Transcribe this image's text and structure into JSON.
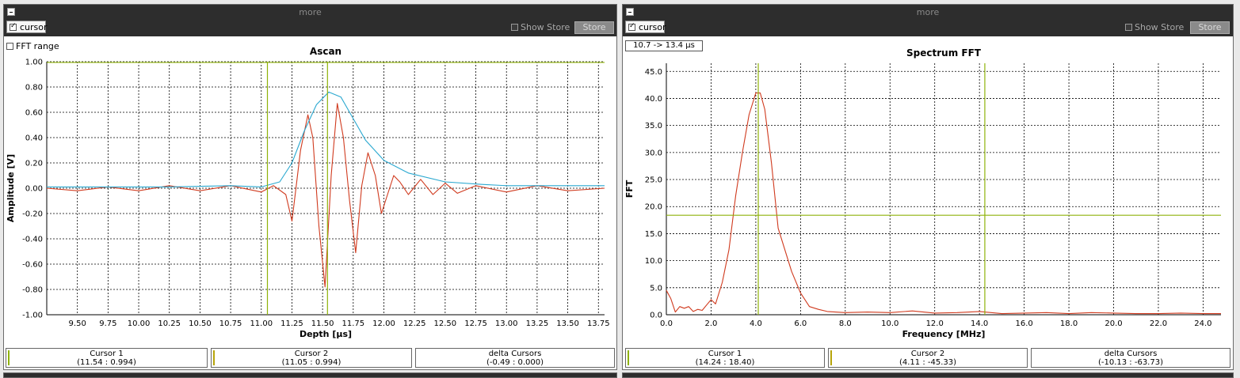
{
  "colors": {
    "wave": "#d03a1e",
    "envelope": "#2aa8d0",
    "cursor": "#8fb20a",
    "grid": "#000000",
    "titlebar": "#2d2d2d"
  },
  "panels": [
    {
      "header": {
        "title": "more"
      },
      "toolbar": {
        "cursor_label": "cursor",
        "cursor_checked": true,
        "show_store_label": "Show Store",
        "store_label": "Store"
      },
      "fft_range_label": "FFT range",
      "readouts": [
        {
          "label": "Cursor 1",
          "value": "(11.54 : 0.994)"
        },
        {
          "label": "Cursor 2",
          "value": "(11.05 : 0.994)"
        },
        {
          "label": "delta Cursors",
          "value": "(-0.49 : 0.000)"
        }
      ]
    },
    {
      "header": {
        "title": "more"
      },
      "toolbar": {
        "cursor_label": "cursor",
        "cursor_checked": true,
        "show_store_label": "Show Store",
        "store_label": "Store"
      },
      "range_label": "10.7 -> 13.4 µs",
      "readouts": [
        {
          "label": "Cursor 1",
          "value": "(14.24 : 18.40)"
        },
        {
          "label": "Cursor 2",
          "value": "(4.11 : -45.33)"
        },
        {
          "label": "delta Cursors",
          "value": "(-10.13 : -63.73)"
        }
      ]
    }
  ],
  "chart_data": [
    {
      "type": "line",
      "title": "Ascan",
      "xlabel": "Depth [µs]",
      "ylabel": "Amplitude [V]",
      "xlim": [
        9.25,
        13.8
      ],
      "ylim": [
        -1.0,
        1.0
      ],
      "grid": true,
      "xticks": [
        9.5,
        9.75,
        10.0,
        10.25,
        10.5,
        10.75,
        11.0,
        11.25,
        11.5,
        11.75,
        12.0,
        12.25,
        12.5,
        12.75,
        13.0,
        13.25,
        13.5,
        13.75
      ],
      "xtick_labels": [
        "9.50",
        "9.75",
        "10.00",
        "10.25",
        "10.50",
        "10.75",
        "11.00",
        "11.25",
        "11.50",
        "11.75",
        "12.00",
        "12.25",
        "12.50",
        "12.75",
        "13.00",
        "13.25",
        "13.50",
        "13.75"
      ],
      "yticks": [
        1.0,
        0.8,
        0.6,
        0.4,
        0.2,
        0.0,
        -0.2,
        -0.4,
        -0.6,
        -0.8,
        -1.0
      ],
      "ytick_labels": [
        "1.00",
        "0.80",
        "0.60",
        "0.40",
        "0.20",
        "0.00",
        "-0.20",
        "-0.40",
        "-0.60",
        "-0.80",
        "-1.00"
      ],
      "cursors": {
        "x": [
          11.05,
          11.54
        ],
        "y": [
          0.994
        ]
      },
      "series": [
        {
          "color": "#d03a1e",
          "x": [
            9.25,
            9.5,
            9.75,
            10.0,
            10.25,
            10.5,
            10.75,
            11.0,
            11.1,
            11.2,
            11.25,
            11.32,
            11.38,
            11.42,
            11.47,
            11.52,
            11.57,
            11.62,
            11.67,
            11.72,
            11.77,
            11.82,
            11.87,
            11.93,
            11.98,
            12.03,
            12.08,
            12.13,
            12.2,
            12.3,
            12.4,
            12.5,
            12.6,
            12.75,
            13.0,
            13.25,
            13.5,
            13.8
          ],
          "y": [
            0.0,
            -0.02,
            0.01,
            -0.02,
            0.02,
            -0.02,
            0.02,
            -0.03,
            0.02,
            -0.05,
            -0.26,
            0.3,
            0.58,
            0.4,
            -0.3,
            -0.78,
            0.1,
            0.67,
            0.4,
            -0.1,
            -0.51,
            0.02,
            0.28,
            0.1,
            -0.2,
            -0.05,
            0.1,
            0.05,
            -0.05,
            0.07,
            -0.05,
            0.04,
            -0.04,
            0.02,
            -0.03,
            0.02,
            -0.02,
            0.0
          ]
        },
        {
          "color": "#2aa8d0",
          "x": [
            9.25,
            9.75,
            10.25,
            10.75,
            11.0,
            11.15,
            11.25,
            11.35,
            11.45,
            11.55,
            11.65,
            11.75,
            11.85,
            12.0,
            12.2,
            12.5,
            12.8,
            13.0,
            13.5,
            13.8
          ],
          "y": [
            0.01,
            0.01,
            0.01,
            0.02,
            0.01,
            0.05,
            0.2,
            0.45,
            0.66,
            0.76,
            0.72,
            0.55,
            0.38,
            0.22,
            0.12,
            0.05,
            0.03,
            0.02,
            0.02,
            0.02
          ]
        }
      ]
    },
    {
      "type": "line",
      "title": "Spectrum FFT",
      "xlabel": "Frequency [MHz]",
      "ylabel": "FFT",
      "xlim": [
        0,
        24.8
      ],
      "ylim": [
        0,
        46.5
      ],
      "grid": true,
      "xticks": [
        0,
        2,
        4,
        6,
        8,
        10,
        12,
        14,
        16,
        18,
        20,
        22,
        24
      ],
      "xtick_labels": [
        "0.0",
        "2.0",
        "4.0",
        "6.0",
        "8.0",
        "10.0",
        "12.0",
        "14.0",
        "16.0",
        "18.0",
        "20.0",
        "22.0",
        "24.0"
      ],
      "yticks": [
        0,
        5,
        10,
        15,
        20,
        25,
        30,
        35,
        40,
        45
      ],
      "ytick_labels": [
        "0.0",
        "5.0",
        "10.0",
        "15.0",
        "20.0",
        "25.0",
        "30.0",
        "35.0",
        "40.0",
        "45.0"
      ],
      "cursors": {
        "x": [
          4.11,
          14.24
        ],
        "y": [
          18.4
        ]
      },
      "series": [
        {
          "color": "#d03a1e",
          "x": [
            0,
            0.2,
            0.4,
            0.6,
            0.8,
            1.0,
            1.2,
            1.4,
            1.6,
            1.8,
            2.0,
            2.2,
            2.5,
            2.8,
            3.1,
            3.4,
            3.7,
            4.0,
            4.2,
            4.4,
            4.7,
            5.0,
            5.3,
            5.6,
            6.0,
            6.4,
            6.8,
            7.2,
            8.0,
            9.0,
            10.0,
            11.0,
            12.0,
            13.0,
            14.0,
            15.0,
            16.0,
            17.0,
            18.0,
            19.0,
            20.0,
            21.0,
            22.0,
            23.0,
            24.0,
            24.8
          ],
          "y": [
            4.5,
            3.0,
            0.5,
            1.5,
            1.2,
            1.5,
            0.6,
            1.0,
            0.8,
            1.8,
            2.8,
            2.0,
            6.0,
            12.0,
            22.0,
            30.0,
            37.0,
            41.0,
            41.0,
            38.0,
            28.0,
            16.0,
            12.0,
            8.0,
            4.0,
            1.5,
            1.0,
            0.6,
            0.4,
            0.5,
            0.4,
            0.7,
            0.3,
            0.4,
            0.6,
            0.2,
            0.3,
            0.4,
            0.2,
            0.4,
            0.3,
            0.2,
            0.2,
            0.3,
            0.2,
            0.2
          ]
        }
      ]
    }
  ]
}
